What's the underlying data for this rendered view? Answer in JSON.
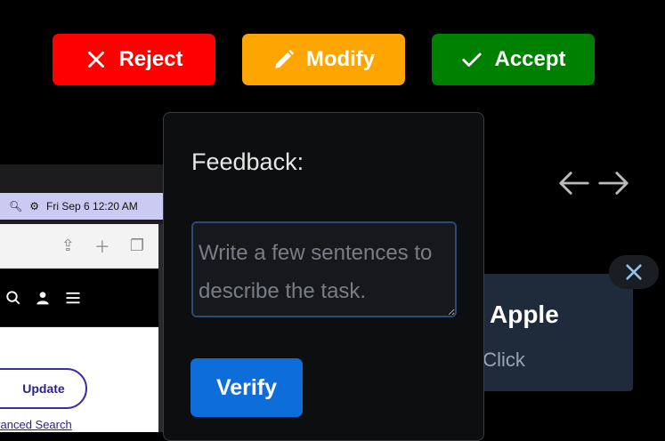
{
  "actions": {
    "reject_label": "Reject",
    "modify_label": "Modify",
    "accept_label": "Accept",
    "colors": {
      "reject": "#ff0000",
      "modify": "#ffa500",
      "accept": "#008000"
    }
  },
  "background_shot": {
    "menubar_datetime": "Fri Sep 6  12:20 AM",
    "update_label": "Update",
    "advanced_search_text": "vanced Search"
  },
  "card": {
    "title": "Apple",
    "subtitle": "t Click"
  },
  "feedback": {
    "label": "Feedback:",
    "placeholder": "Write a few sentences to describe the task.",
    "value": "",
    "verify_label": "Verify"
  },
  "icons": [
    "close-icon",
    "pencil-icon",
    "check-icon",
    "arrow-left-icon",
    "arrow-right-icon",
    "search-icon",
    "user-icon",
    "menu-icon",
    "share-icon",
    "plus-icon",
    "tabs-icon"
  ]
}
